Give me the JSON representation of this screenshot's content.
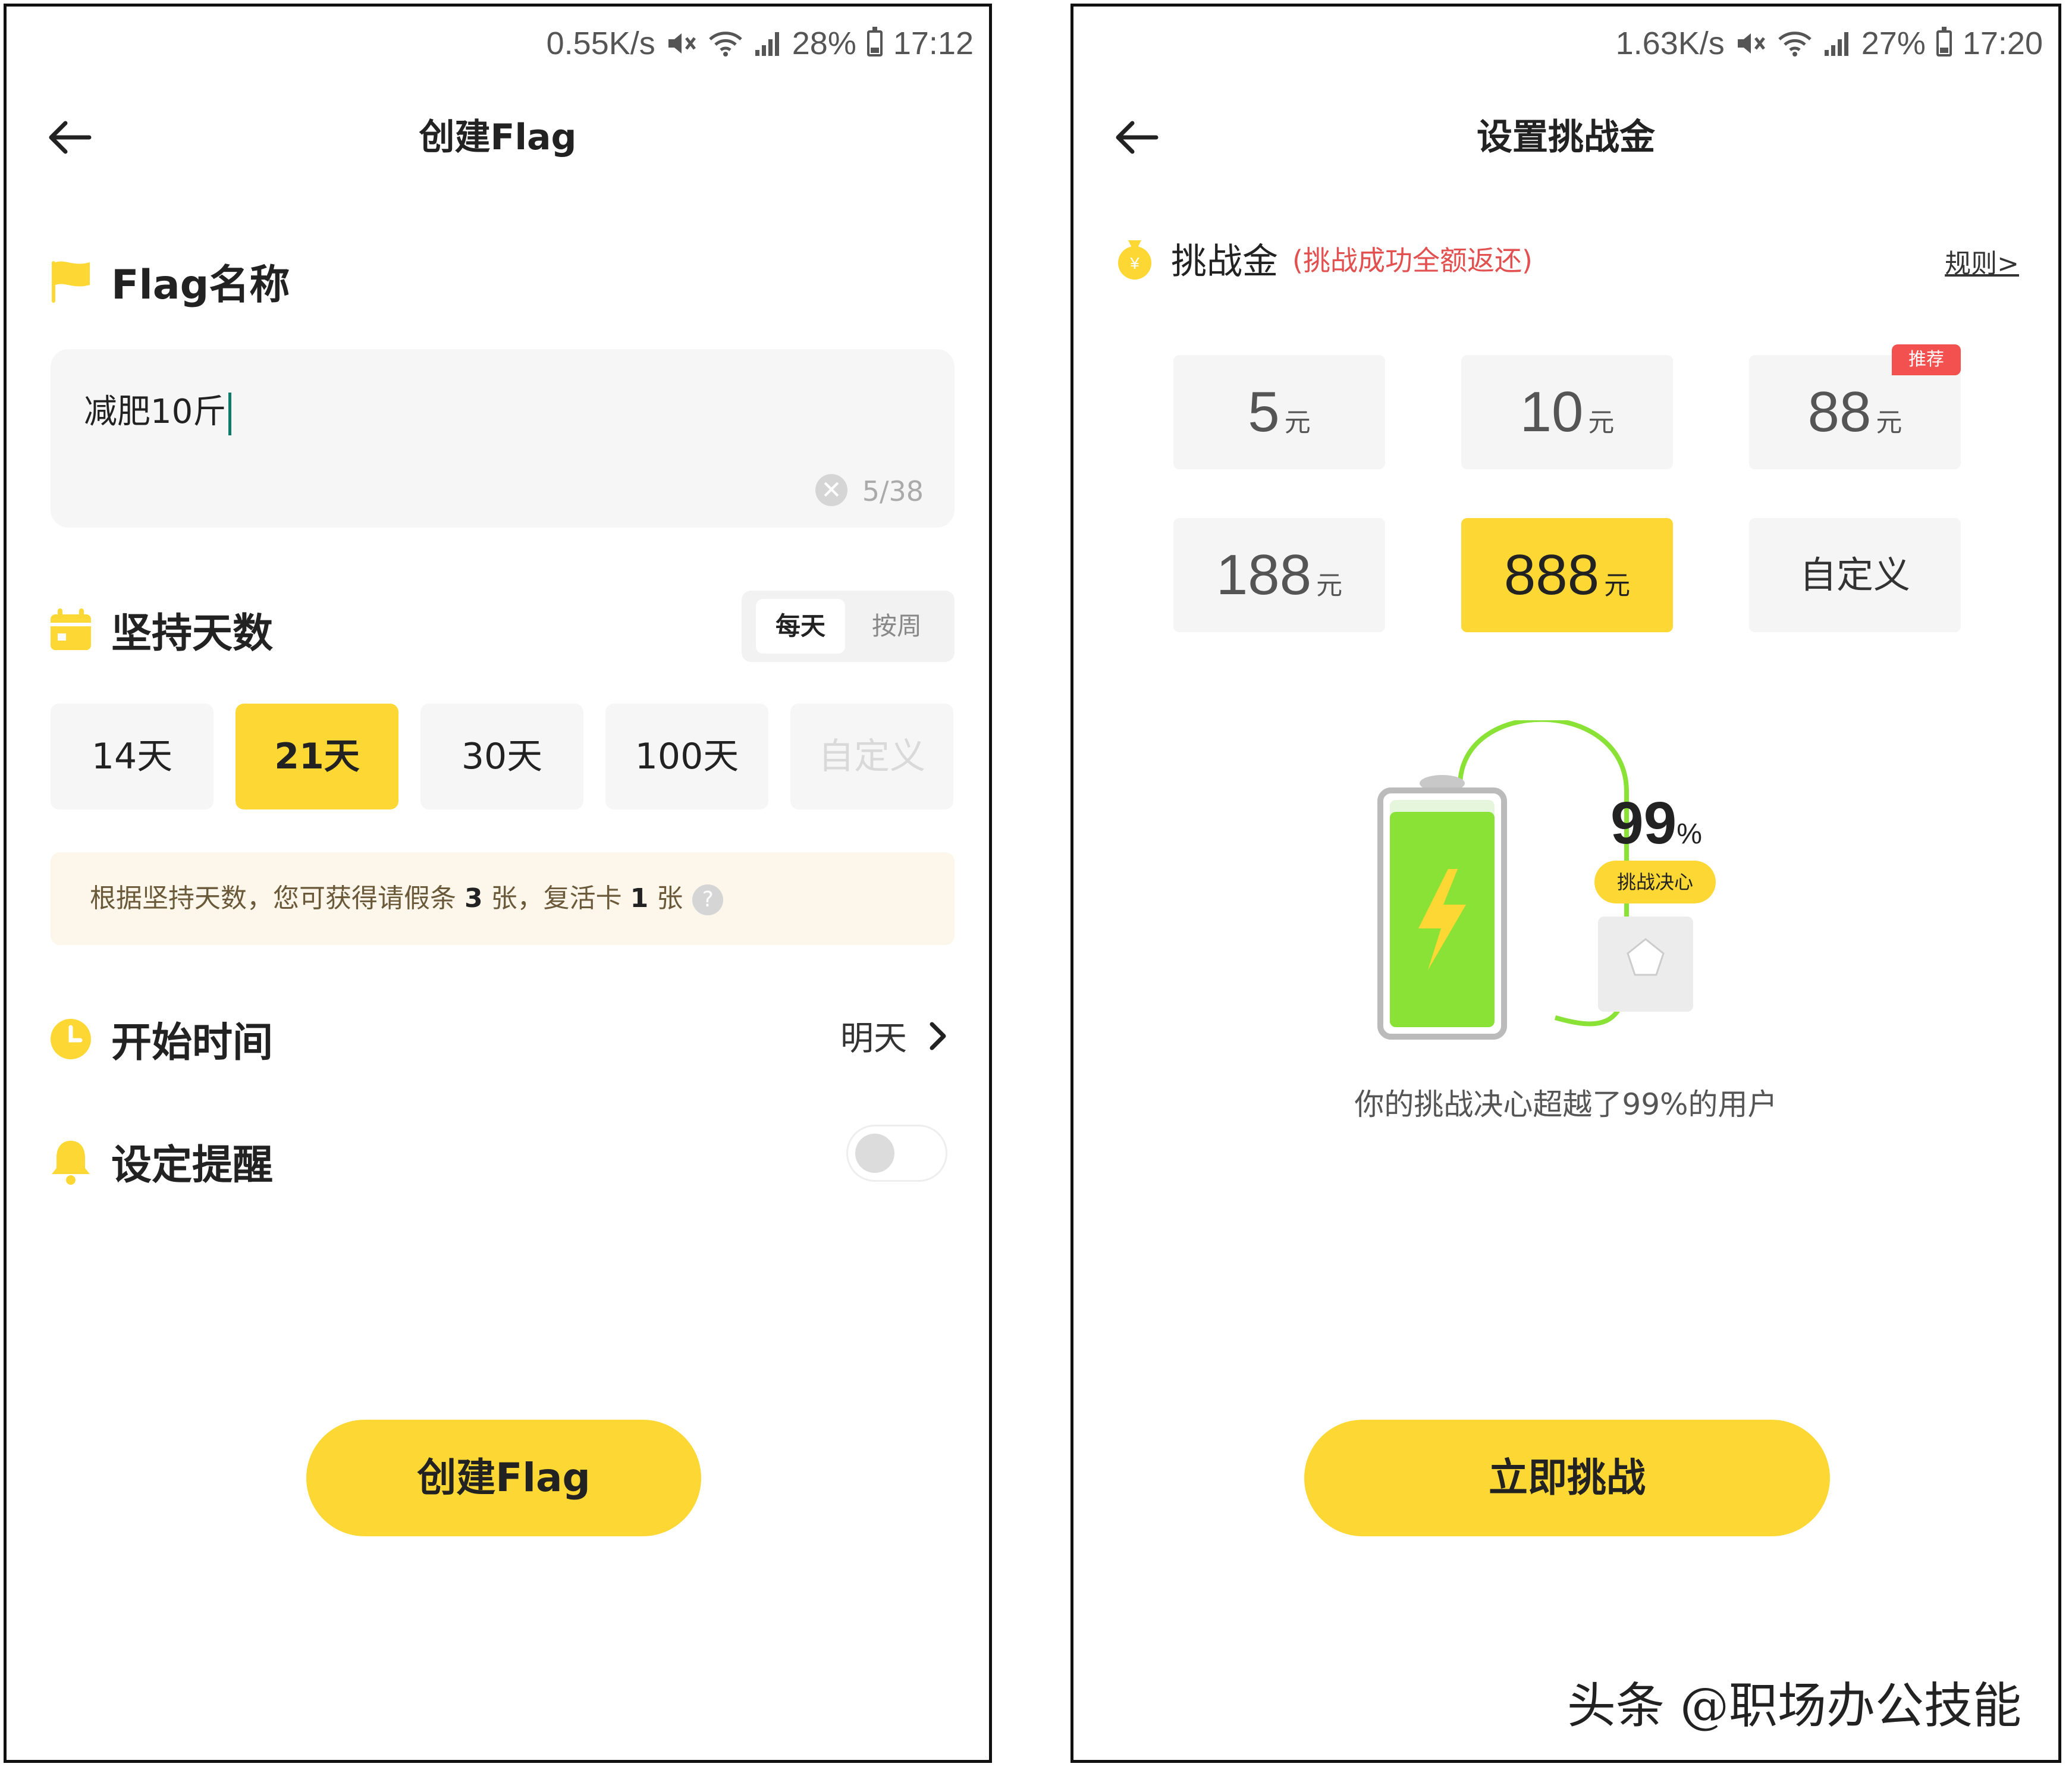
{
  "left": {
    "status": {
      "speed": "0.55K/s",
      "battery_pct": "28%",
      "battery_level": 0.28,
      "time": "17:12"
    },
    "title": "创建Flag",
    "flag_name": {
      "label": "Flag名称",
      "value": "减肥10斤",
      "counter": "5/38"
    },
    "days": {
      "label": "坚持天数",
      "toggle_options": [
        "每天",
        "按周"
      ],
      "options": [
        "14天",
        "21天",
        "30天",
        "100天",
        "自定义"
      ],
      "selected": "21天"
    },
    "notice": {
      "prefix": "根据坚持天数，您可获得请假条",
      "leave_count": "3",
      "mid": "张，复活卡",
      "revive_count": "1",
      "suffix": "张"
    },
    "start_time": {
      "label": "开始时间",
      "value": "明天"
    },
    "reminder": {
      "label": "设定提醒",
      "enabled": false
    },
    "primary_button": "创建Flag"
  },
  "right": {
    "status": {
      "speed": "1.63K/s",
      "battery_pct": "27%",
      "battery_level": 0.27,
      "time": "17:20"
    },
    "title": "设置挑战金",
    "amount_label": "挑战金",
    "amount_note": "(挑战成功全额返还)",
    "rules_link": "规则>",
    "unit": "元",
    "amounts": [
      {
        "value": "5"
      },
      {
        "value": "10"
      },
      {
        "value": "88",
        "badge": "推荐"
      },
      {
        "value": "188"
      },
      {
        "value": "888"
      },
      {
        "label": "自定义"
      }
    ],
    "selected_amount": "888",
    "illustration": {
      "percent": "99",
      "percent_sign": "%",
      "pill": "挑战决心",
      "battery_fill": 0.99
    },
    "caption": "你的挑战决心超越了99%的用户",
    "primary_button": "立即挑战"
  },
  "watermark": "头条 @职场办公技能",
  "colors": {
    "accent": "#fdd835",
    "red": "#e25050",
    "green": "#8ae237",
    "text": "#222222"
  }
}
